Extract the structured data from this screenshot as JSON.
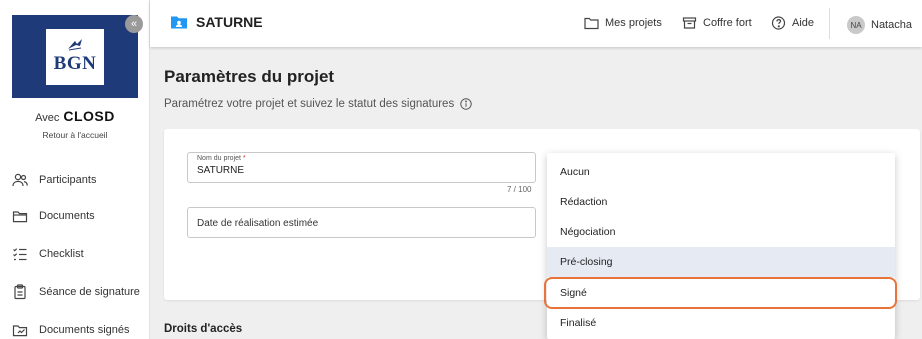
{
  "sidebar": {
    "logo_text": "BGN",
    "collapse_glyph": "«",
    "avec_label": "Avec",
    "brand": "CLOSD",
    "retour": "Retour à l'accueil",
    "items": [
      {
        "label": "Participants",
        "icon": "participants-icon"
      },
      {
        "label": "Documents",
        "icon": "folder-icon"
      },
      {
        "label": "Checklist",
        "icon": "checklist-icon"
      },
      {
        "label": "Séance de signature",
        "icon": "clipboard-icon"
      },
      {
        "label": "Documents signés",
        "icon": "signed-documents-icon"
      }
    ]
  },
  "topbar": {
    "project_name": "SATURNE",
    "links": {
      "projects": "Mes projets",
      "vault": "Coffre fort",
      "help": "Aide"
    },
    "user": {
      "initials": "NA",
      "name": "Natacha"
    }
  },
  "main": {
    "title": "Paramètres du projet",
    "subtitle": "Paramétrez votre projet et suivez le statut des signatures",
    "project_name_field": {
      "label": "Nom du projet",
      "required_mark": "*",
      "value": "SATURNE",
      "counter": "7 / 100"
    },
    "date_field": {
      "placeholder": "Date de réalisation estimée"
    },
    "access_title": "Droits d'accès"
  },
  "status_dropdown": {
    "options": [
      "Aucun",
      "Rédaction",
      "Négociation",
      "Pré-closing",
      "Signé",
      "Finalisé"
    ],
    "hovered": "Pré-closing",
    "highlighted": "Signé"
  },
  "colors": {
    "accent": "#1e3a78",
    "highlight_border": "#e8743b",
    "hover_bg": "#e6eaf3",
    "folder_blue": "#2196f3"
  }
}
